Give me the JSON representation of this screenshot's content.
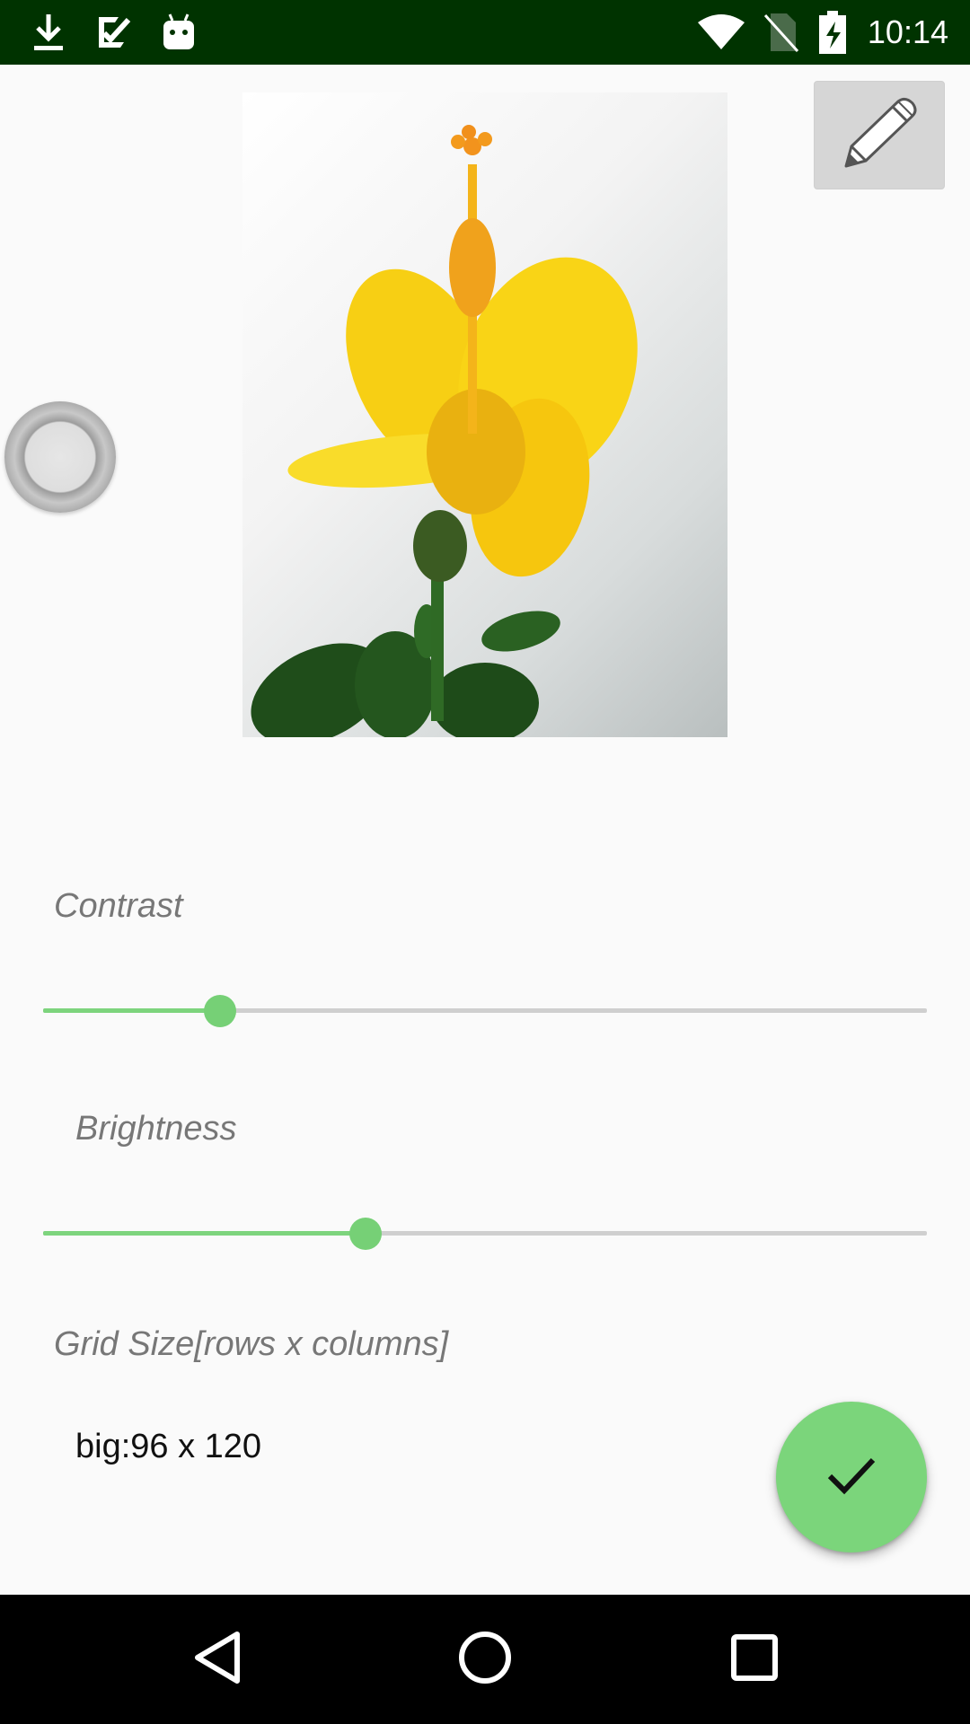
{
  "status_bar": {
    "time": "10:14",
    "left_icons": [
      "download-icon",
      "checklist-icon",
      "android-icon"
    ],
    "right_icons": [
      "wifi-icon",
      "no-sim-icon",
      "battery-charging-icon"
    ]
  },
  "photo": {
    "description_icon": "flower-photo"
  },
  "edit_button": {
    "icon": "pencil-icon"
  },
  "contrast": {
    "label": "Contrast",
    "value_fraction": 0.2
  },
  "brightness": {
    "label": "Brightness",
    "value_fraction": 0.365
  },
  "grid_size": {
    "label": "Grid Size[rows x columns]",
    "value": "big:96  x 120"
  },
  "fab": {
    "icon": "check-icon"
  },
  "nav_bar": {
    "icons": [
      "back-icon",
      "home-icon",
      "recents-icon"
    ]
  },
  "colors": {
    "status_bar": "#003300",
    "accent": "#7bd57b",
    "background": "#fafafa"
  }
}
